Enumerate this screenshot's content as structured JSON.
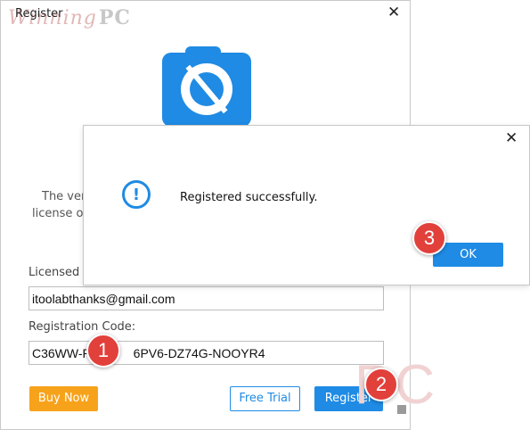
{
  "register_window": {
    "title": "Register",
    "close_glyph": "✕",
    "partial_text_line1": "The ver",
    "partial_text_line2": "license o",
    "licensed_label": "Licensed E",
    "licensed_email": "itoolabthanks@gmail.com",
    "registration_code_label": "Registration Code:",
    "registration_code": "C36WW-P2",
    "registration_code_tail": "6PV6-DZ74G-NOOYR4",
    "buy_now_label": "Buy Now",
    "free_trial_label": "Free Trial",
    "register_label": "Register"
  },
  "watermarks": {
    "top": "Winning",
    "top_pc": "PC",
    "corner": "PC"
  },
  "dialog": {
    "close_glyph": "✕",
    "icon_glyph": "!",
    "message": "Registered successfully.",
    "ok_label": "OK"
  },
  "steps": [
    "1",
    "2",
    "3"
  ],
  "colors": {
    "accent_blue": "#1f8be4",
    "buy_orange": "#f7a21b",
    "badge_red": "#e2403b"
  }
}
